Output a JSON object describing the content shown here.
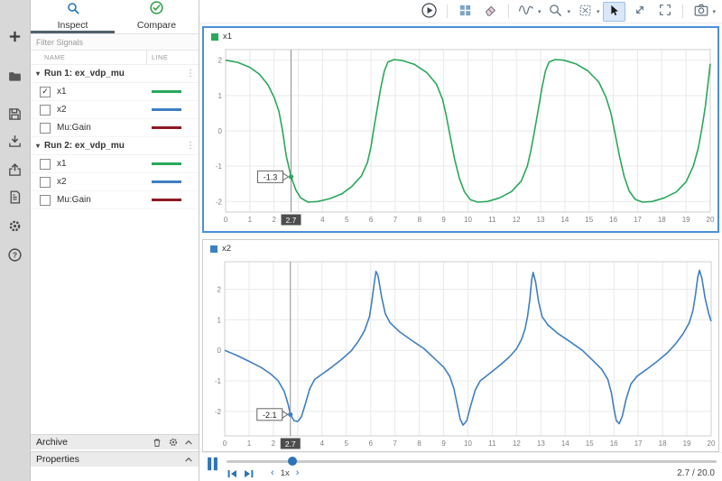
{
  "icons": {
    "expander": "▾",
    "menu": "⋮",
    "check": "✓",
    "caret": "▾",
    "speed_dec": "‹",
    "speed_inc": "›",
    "question": "?"
  },
  "sidebar": {
    "tabs": [
      {
        "label": "Inspect",
        "selected": true
      },
      {
        "label": "Compare",
        "selected": false
      }
    ],
    "filter_placeholder": "Filter Signals",
    "columns": {
      "name": "NAME",
      "line": "LINE"
    },
    "groups": [
      {
        "label": "Run 1: ex_vdp_mu",
        "signals": [
          {
            "name": "x1",
            "checked": true,
            "color": "#2aa85c"
          },
          {
            "name": "x2",
            "checked": false,
            "color": "#3f7fc1"
          },
          {
            "name": "Mu:Gain",
            "checked": false,
            "color": "#8e1a22"
          }
        ]
      },
      {
        "label": "Run 2: ex_vdp_mu",
        "signals": [
          {
            "name": "x1",
            "checked": false,
            "color": "#2aa85c"
          },
          {
            "name": "x2",
            "checked": false,
            "color": "#3f7fc1"
          },
          {
            "name": "Mu:Gain",
            "checked": false,
            "color": "#8e1a22"
          }
        ]
      }
    ],
    "archive_label": "Archive",
    "properties_label": "Properties"
  },
  "chart_data": [
    {
      "type": "line",
      "title": "x1",
      "series": [
        {
          "name": "x1",
          "color": "#2aa85c"
        }
      ],
      "xlim": [
        0,
        20
      ],
      "ylim": [
        -2.3,
        2.3
      ],
      "xticks": [
        0,
        1,
        2,
        3,
        4,
        5,
        6,
        7,
        8,
        9,
        10,
        11,
        12,
        13,
        14,
        15,
        16,
        17,
        18,
        19,
        20
      ],
      "yticks": [
        -2,
        -1,
        0,
        1,
        2
      ],
      "grid": true,
      "selected": true,
      "cursor": {
        "t": 2.7,
        "value": -1.3,
        "label": "-1.3",
        "tag": "2.7"
      },
      "points": [
        [
          0,
          2.0
        ],
        [
          0.5,
          1.94
        ],
        [
          1.0,
          1.8
        ],
        [
          1.4,
          1.6
        ],
        [
          1.75,
          1.3
        ],
        [
          2.0,
          0.95
        ],
        [
          2.2,
          0.55
        ],
        [
          2.35,
          0.0
        ],
        [
          2.5,
          -0.7
        ],
        [
          2.7,
          -1.3
        ],
        [
          2.9,
          -1.68
        ],
        [
          3.1,
          -1.9
        ],
        [
          3.4,
          -2.02
        ],
        [
          3.8,
          -2.0
        ],
        [
          4.3,
          -1.92
        ],
        [
          4.8,
          -1.78
        ],
        [
          5.2,
          -1.58
        ],
        [
          5.6,
          -1.28
        ],
        [
          5.85,
          -0.9
        ],
        [
          6.0,
          -0.45
        ],
        [
          6.1,
          0.0
        ],
        [
          6.25,
          0.6
        ],
        [
          6.4,
          1.2
        ],
        [
          6.55,
          1.7
        ],
        [
          6.7,
          1.95
        ],
        [
          6.95,
          2.02
        ],
        [
          7.3,
          1.99
        ],
        [
          7.8,
          1.88
        ],
        [
          8.3,
          1.65
        ],
        [
          8.7,
          1.32
        ],
        [
          8.95,
          0.9
        ],
        [
          9.1,
          0.45
        ],
        [
          9.25,
          -0.1
        ],
        [
          9.45,
          -0.8
        ],
        [
          9.65,
          -1.35
        ],
        [
          9.85,
          -1.72
        ],
        [
          10.1,
          -1.95
        ],
        [
          10.4,
          -2.02
        ],
        [
          10.8,
          -2.0
        ],
        [
          11.3,
          -1.9
        ],
        [
          11.8,
          -1.72
        ],
        [
          12.2,
          -1.42
        ],
        [
          12.45,
          -1.0
        ],
        [
          12.6,
          -0.55
        ],
        [
          12.75,
          0.0
        ],
        [
          12.9,
          0.6
        ],
        [
          13.05,
          1.2
        ],
        [
          13.2,
          1.7
        ],
        [
          13.35,
          1.95
        ],
        [
          13.6,
          2.02
        ],
        [
          13.95,
          2.0
        ],
        [
          14.45,
          1.9
        ],
        [
          14.95,
          1.7
        ],
        [
          15.4,
          1.38
        ],
        [
          15.7,
          0.95
        ],
        [
          15.9,
          0.5
        ],
        [
          16.05,
          0.0
        ],
        [
          16.25,
          -0.7
        ],
        [
          16.45,
          -1.3
        ],
        [
          16.65,
          -1.7
        ],
        [
          16.9,
          -1.94
        ],
        [
          17.2,
          -2.02
        ],
        [
          17.6,
          -2.0
        ],
        [
          18.1,
          -1.9
        ],
        [
          18.6,
          -1.73
        ],
        [
          19.0,
          -1.45
        ],
        [
          19.3,
          -1.0
        ],
        [
          19.5,
          -0.5
        ],
        [
          19.65,
          0.05
        ],
        [
          19.8,
          0.7
        ],
        [
          19.9,
          1.3
        ],
        [
          20,
          1.9
        ]
      ]
    },
    {
      "type": "line",
      "title": "x2",
      "series": [
        {
          "name": "x2",
          "color": "#3f7fc1"
        }
      ],
      "xlim": [
        0,
        20
      ],
      "ylim": [
        -2.8,
        2.9
      ],
      "xticks": [
        0,
        1,
        2,
        3,
        4,
        5,
        6,
        7,
        8,
        9,
        10,
        11,
        12,
        13,
        14,
        15,
        16,
        17,
        18,
        19,
        20
      ],
      "yticks": [
        -2,
        -1,
        0,
        1,
        2
      ],
      "grid": true,
      "selected": false,
      "cursor": {
        "t": 2.7,
        "value": -2.1,
        "label": "-2.1",
        "tag": "2.7"
      },
      "points": [
        [
          0,
          0.0
        ],
        [
          0.5,
          -0.17
        ],
        [
          1.0,
          -0.36
        ],
        [
          1.5,
          -0.56
        ],
        [
          1.9,
          -0.78
        ],
        [
          2.2,
          -1.0
        ],
        [
          2.45,
          -1.35
        ],
        [
          2.6,
          -1.75
        ],
        [
          2.7,
          -2.1
        ],
        [
          2.85,
          -2.3
        ],
        [
          3.0,
          -2.33
        ],
        [
          3.15,
          -2.18
        ],
        [
          3.3,
          -1.8
        ],
        [
          3.5,
          -1.25
        ],
        [
          3.7,
          -0.95
        ],
        [
          4.0,
          -0.78
        ],
        [
          4.4,
          -0.55
        ],
        [
          4.8,
          -0.3
        ],
        [
          5.2,
          -0.02
        ],
        [
          5.5,
          0.3
        ],
        [
          5.75,
          0.65
        ],
        [
          5.95,
          1.1
        ],
        [
          6.05,
          1.6
        ],
        [
          6.15,
          2.2
        ],
        [
          6.22,
          2.58
        ],
        [
          6.3,
          2.45
        ],
        [
          6.45,
          1.75
        ],
        [
          6.6,
          1.2
        ],
        [
          6.8,
          0.9
        ],
        [
          7.2,
          0.6
        ],
        [
          7.7,
          0.32
        ],
        [
          8.2,
          0.05
        ],
        [
          8.6,
          -0.25
        ],
        [
          9.0,
          -0.55
        ],
        [
          9.25,
          -0.85
        ],
        [
          9.42,
          -1.25
        ],
        [
          9.55,
          -1.75
        ],
        [
          9.68,
          -2.25
        ],
        [
          9.8,
          -2.45
        ],
        [
          9.95,
          -2.3
        ],
        [
          10.1,
          -1.85
        ],
        [
          10.3,
          -1.3
        ],
        [
          10.5,
          -1.0
        ],
        [
          10.9,
          -0.75
        ],
        [
          11.3,
          -0.5
        ],
        [
          11.7,
          -0.22
        ],
        [
          12.0,
          0.05
        ],
        [
          12.2,
          0.35
        ],
        [
          12.35,
          0.7
        ],
        [
          12.45,
          1.1
        ],
        [
          12.55,
          1.7
        ],
        [
          12.62,
          2.3
        ],
        [
          12.68,
          2.55
        ],
        [
          12.78,
          2.25
        ],
        [
          12.9,
          1.6
        ],
        [
          13.05,
          1.1
        ],
        [
          13.3,
          0.82
        ],
        [
          13.7,
          0.55
        ],
        [
          14.2,
          0.28
        ],
        [
          14.7,
          0.0
        ],
        [
          15.1,
          -0.3
        ],
        [
          15.5,
          -0.62
        ],
        [
          15.75,
          -0.95
        ],
        [
          15.9,
          -1.4
        ],
        [
          16.0,
          -1.9
        ],
        [
          16.1,
          -2.3
        ],
        [
          16.22,
          -2.4
        ],
        [
          16.35,
          -2.15
        ],
        [
          16.5,
          -1.6
        ],
        [
          16.7,
          -1.1
        ],
        [
          16.95,
          -0.85
        ],
        [
          17.35,
          -0.62
        ],
        [
          17.8,
          -0.35
        ],
        [
          18.2,
          -0.08
        ],
        [
          18.55,
          0.22
        ],
        [
          18.85,
          0.55
        ],
        [
          19.1,
          0.9
        ],
        [
          19.25,
          1.3
        ],
        [
          19.35,
          1.8
        ],
        [
          19.45,
          2.4
        ],
        [
          19.52,
          2.62
        ],
        [
          19.62,
          2.35
        ],
        [
          19.75,
          1.7
        ],
        [
          19.9,
          1.2
        ],
        [
          20,
          0.95
        ]
      ]
    }
  ],
  "playback": {
    "speed": "1x",
    "current": 2.7,
    "total": 20.0,
    "display": "2.7 / 20.0"
  }
}
